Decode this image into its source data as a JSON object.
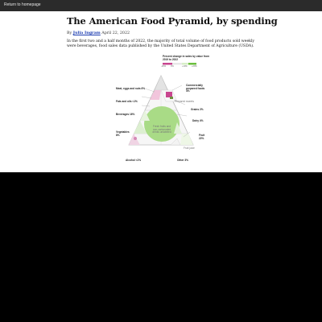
{
  "nav": {
    "return_link": "Return to homepage"
  },
  "article": {
    "title": "The American Food Pyramid, by spending",
    "byline_prefix": "By",
    "author": "Julia Ingram",
    "date": "April 22, 2022",
    "summary": "In the first two and a half months of 2022, the majority of total volume of food products sold weekly were beverages, food sales data published by the United States Department of Agriculture (USDA)."
  },
  "figure": {
    "legend_title": "Percent change in sales by value from 2019 to 2022",
    "legend_ticks": [
      "-20%",
      "0%",
      "+10%",
      "+20%"
    ],
    "labels": {
      "commercially_prepared": "Commercially prepared foods 4%",
      "meat": "Meat, eggs and nuts 6%",
      "fats": "Fats and oils <1%",
      "beverages": "Beverages 16%",
      "grains": "Grains 2%",
      "dairy": "Dairy 4%",
      "vegetables": "Vegetables 8%",
      "fruit": "Fruit 22%",
      "alcohol": "Alcohol <1%",
      "other": "Other 3%",
      "center": "Fresh fruits and non-carbonated drinks unlabeled",
      "prepared_sweets": "Prepared sweets",
      "fruit_juice": "Fruit juice"
    },
    "colors": {
      "positive": "#8fcf6a",
      "negative": "#c8458f",
      "neutral": "#e8e8e8",
      "light_green": "#d7efc7",
      "light_pink": "#f2c5dc"
    }
  }
}
